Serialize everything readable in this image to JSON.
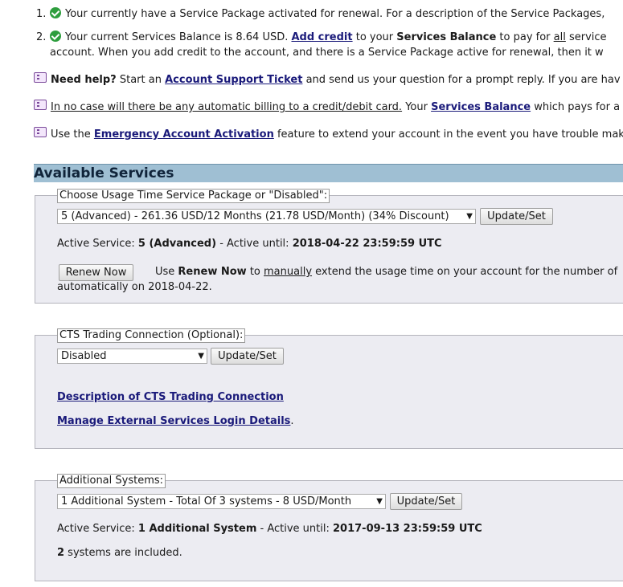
{
  "status_list": {
    "item1": {
      "number": "1.",
      "text": "Your currently have a Service Package activated for renewal. For a description of the Service Packages,"
    },
    "item2": {
      "number": "2.",
      "part1": "Your current Services Balance is 8.64 USD. ",
      "add_credit_link": "Add credit",
      "part2": " to your ",
      "services_balance_bold": "Services Balance",
      "part3": " to pay for ",
      "all_underlined": "all",
      "part4": " service",
      "line2": "account. When you add credit to the account, and there is a Service Package active for renewal, then it w"
    }
  },
  "notes": {
    "help": {
      "bold": "Need help?",
      "text1": " Start an ",
      "link": "Account Support Ticket",
      "text2": " and send us your question for a prompt reply. If you are hav"
    },
    "billing": {
      "underlined": "In no case will there be any automatic billing to a credit/debit card.",
      "text1": " Your ",
      "link": "Services Balance",
      "text2": " which pays for a"
    },
    "emergency": {
      "text1": "Use the ",
      "link": "Emergency Account Activation",
      "text2": " feature to extend your account in the event you have trouble mak"
    }
  },
  "available_services": {
    "title": "Available Services"
  },
  "usage_panel": {
    "legend": "Choose Usage Time Service Package or \"Disabled\":",
    "selected_option": "5 (Advanced) - 261.36 USD/12 Months (21.78 USD/Month) (34% Discount)",
    "update_button": "Update/Set",
    "active_label": "Active Service: ",
    "active_value": "5 (Advanced)",
    "active_until_label": " - Active until: ",
    "active_until_value": "2018-04-22 23:59:59 UTC",
    "renew_button": "Renew Now",
    "renew_text1": "Use ",
    "renew_bold": "Renew Now",
    "renew_text2": " to ",
    "renew_underlined": "manually",
    "renew_text3": " extend the usage time on your account for the number of",
    "renew_line2": "automatically on 2018-04-22."
  },
  "cts_panel": {
    "legend": "CTS Trading Connection (Optional):",
    "selected_option": "Disabled",
    "update_button": "Update/Set",
    "description_link": "Description of CTS Trading Connection",
    "manage_link": "Manage External Services Login Details",
    "manage_suffix": "."
  },
  "additional_panel": {
    "legend": "Additional Systems:",
    "selected_option": "1 Additional System - Total Of 3 systems - 8 USD/Month",
    "update_button": "Update/Set",
    "active_label": "Active Service: ",
    "active_value": "1 Additional System",
    "active_until_label": " - Active until: ",
    "active_until_value": "2017-09-13 23:59:59 UTC",
    "systems_count": "2",
    "systems_text": " systems are included."
  },
  "icons": {
    "check": "check-circle-icon",
    "note": "chat-bubble-icon",
    "dropdown": "dropdown-arrow-icon"
  },
  "colors": {
    "header_bg": "#9fbfd3",
    "panel_bg": "#ececf2",
    "link": "#1a1a7a",
    "check_green": "#2e9e3e"
  }
}
